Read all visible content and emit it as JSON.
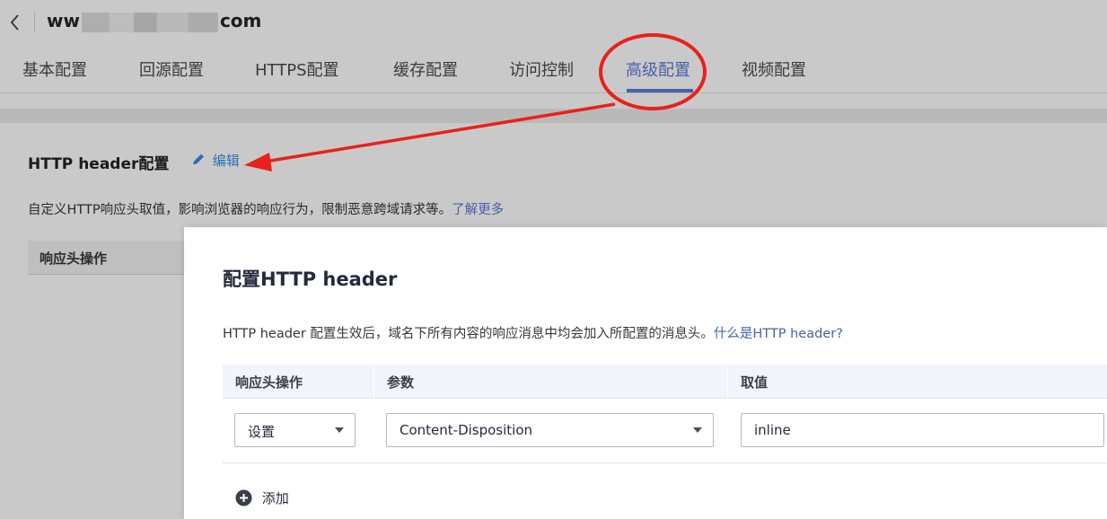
{
  "header": {
    "domain_prefix": "ww",
    "domain_suffix": "com"
  },
  "tabs": [
    {
      "label": "基本配置"
    },
    {
      "label": "回源配置"
    },
    {
      "label": "HTTPS配置"
    },
    {
      "label": "缓存配置"
    },
    {
      "label": "访问控制"
    },
    {
      "label": "高级配置",
      "active": true
    },
    {
      "label": "视频配置"
    }
  ],
  "section": {
    "title": "HTTP header配置",
    "edit_label": "编辑",
    "description": "自定义HTTP响应头取值，影响浏览器的响应行为，限制恶意跨域请求等。",
    "learn_more": "了解更多",
    "table_header": "响应头操作"
  },
  "dialog": {
    "title": "配置HTTP header",
    "description": "HTTP header 配置生效后，域名下所有内容的响应消息中均会加入所配置的消息头。",
    "help_link": "什么是HTTP header?",
    "columns": [
      "响应头操作",
      "参数",
      "取值"
    ],
    "row": {
      "operation": "设置",
      "parameter": "Content-Disposition",
      "value": "inline"
    },
    "add_label": "添加"
  },
  "colors": {
    "accent": "#4a5fa8",
    "annotation": "#e8211c",
    "link": "#2f6fb6"
  },
  "icons": [
    "back-chevron-icon",
    "pencil-icon",
    "caret-down-icon",
    "plus-circle-icon"
  ]
}
